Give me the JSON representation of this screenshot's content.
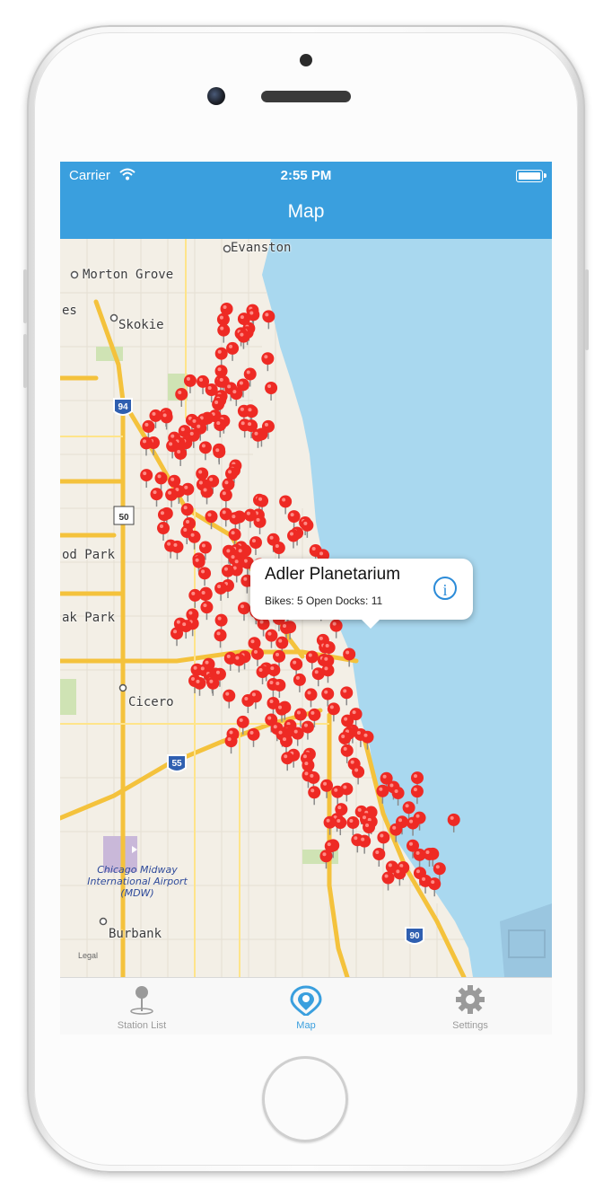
{
  "status": {
    "carrier": "Carrier",
    "time": "2:55 PM"
  },
  "nav": {
    "title": "Map"
  },
  "map": {
    "labels": {
      "evanston": "Evanston",
      "morton_grove": "Morton Grove",
      "es": "es",
      "skokie": "Skokie",
      "od_park": "od Park",
      "ak_park": "ak Park",
      "cicero": "Cicero",
      "airport": "Chicago Midway International Airport (MDW)",
      "burbank": "Burbank",
      "legal": "Legal"
    },
    "highway_shields": [
      "94",
      "50",
      "55",
      "90"
    ]
  },
  "callout": {
    "title": "Adler Planetarium",
    "subtitle": "Bikes: 5 Open Docks: 11"
  },
  "tabs": [
    {
      "label": "Station List",
      "icon": "pin-icon",
      "active": false
    },
    {
      "label": "Map",
      "icon": "map-marker-icon",
      "active": true
    },
    {
      "label": "Settings",
      "icon": "gear-icon",
      "active": false
    }
  ],
  "colors": {
    "accent": "#3a9fde",
    "pin": "#ee2a24",
    "water": "#a9d8ef"
  }
}
